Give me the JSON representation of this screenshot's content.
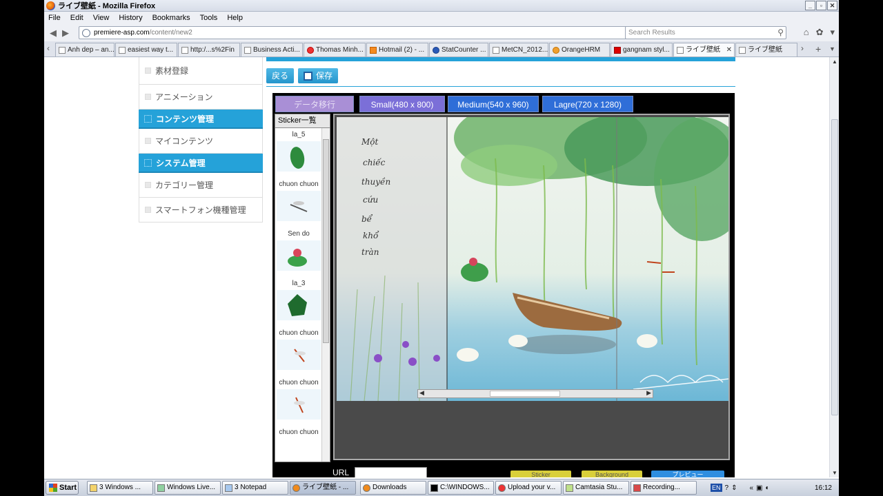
{
  "window": {
    "title": "ライブ壁紙 - Mozilla Firefox",
    "controls": [
      "_",
      "▫",
      "✕"
    ]
  },
  "menubar": [
    "File",
    "Edit",
    "View",
    "History",
    "Bookmarks",
    "Tools",
    "Help"
  ],
  "navbar": {
    "url_host": "premiere-asp.com",
    "url_path": "/content/new2",
    "search_placeholder": "Search Results"
  },
  "tabs": [
    {
      "label": "Anh dep – an..."
    },
    {
      "label": "easiest way t..."
    },
    {
      "label": "http:/...s%2Fin"
    },
    {
      "label": "Business Acti..."
    },
    {
      "label": "Thomas Minh..."
    },
    {
      "label": "Hotmail (2) - ..."
    },
    {
      "label": "StatCounter ..."
    },
    {
      "label": "MetCN_2012..."
    },
    {
      "label": "OrangeHRM"
    },
    {
      "label": "gangnam styl..."
    },
    {
      "label": "ライブ壁紙",
      "active": true
    },
    {
      "label": "ライブ壁紙"
    }
  ],
  "sidemenu": {
    "items": [
      {
        "label": "素材登録",
        "type": "item"
      },
      {
        "label": "アニメーション",
        "type": "item"
      },
      {
        "label": "コンテンツ管理",
        "type": "head"
      },
      {
        "label": "マイコンテンツ",
        "type": "item"
      },
      {
        "label": "システム管理",
        "type": "head"
      },
      {
        "label": "カテゴリー管理",
        "type": "item"
      },
      {
        "label": "スマートフォン機種管理",
        "type": "item"
      }
    ]
  },
  "toolbar": {
    "back_label": "戻る",
    "save_label": "保存"
  },
  "editor": {
    "migrate_label": "データ移行",
    "small_label": "Small(480 x 800)",
    "medium_label": "Medium(540 x 960)",
    "large_label": "Lagre(720 x 1280)",
    "sticker_header": "Sticker一覧",
    "stickers": [
      {
        "label": "la_5"
      },
      {
        "label": "chuon chuon"
      },
      {
        "label": "Sen do"
      },
      {
        "label": "la_3"
      },
      {
        "label": "chuon chuon"
      },
      {
        "label": "chuon chuon"
      },
      {
        "label": "chuon chuon"
      }
    ],
    "url_label": "URL",
    "bottom_buttons": [
      "Sticker",
      "Background",
      "プレビュー"
    ]
  },
  "taskbar": {
    "start_label": "Start",
    "items": [
      {
        "label": "3 Windows ..."
      },
      {
        "label": "Windows Live..."
      },
      {
        "label": "3 Notepad"
      },
      {
        "label": "ライブ壁紙 - ...",
        "active": true
      },
      {
        "label": "Downloads"
      },
      {
        "label": "C:\\WINDOWS..."
      },
      {
        "label": "Upload your v..."
      },
      {
        "label": "Camtasia Stu..."
      },
      {
        "label": "Recording..."
      }
    ],
    "lang": "EN",
    "clock": "16:12"
  },
  "colors": {
    "accent_blue": "#25a2d9",
    "size_button_blue": "#2f6ed8",
    "small_button_purple": "#7b6fd8"
  }
}
